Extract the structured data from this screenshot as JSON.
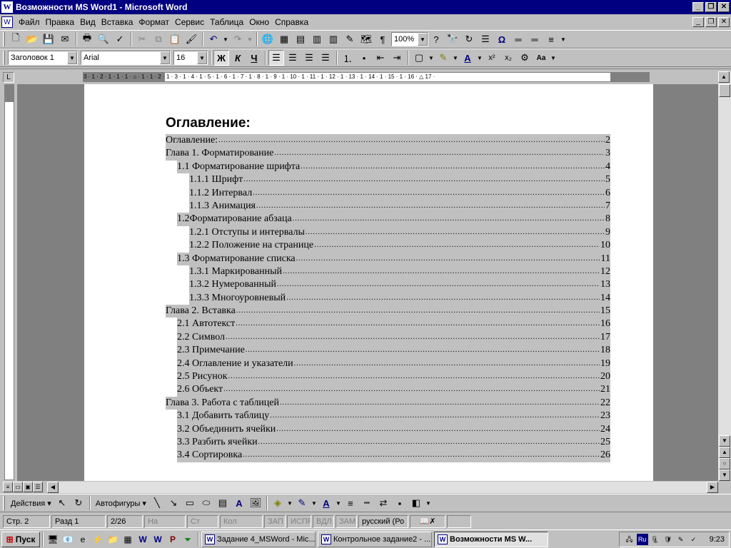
{
  "window": {
    "title": "Возможности MS Word1 - Microsoft Word"
  },
  "menu": [
    "Файл",
    "Правка",
    "Вид",
    "Вставка",
    "Формат",
    "Сервис",
    "Таблица",
    "Окно",
    "Справка"
  ],
  "standard_toolbar": {
    "zoom": "100%"
  },
  "format_toolbar": {
    "style": "Заголовок 1",
    "font": "Arial",
    "size": "16",
    "bold": "Ж",
    "italic": "К",
    "underline": "Ч"
  },
  "ruler": {
    "marks": "3 · 1 · 2 · 1 · 1 · 1 · ⌂ · 1 · 1 · 2 · 1 · 3 · 1 · 4 · 1 · 5 · 1 · 6 · 1 · 7 · 1 · 8 · 1 · 9 · 1 · 10 · 1 · 11 · 1 · 12 · 1 · 13 · 1 · 14 · 1 · 15 · 1 · 16 · △ 17 ·"
  },
  "document": {
    "heading": "Оглавление:",
    "toc": [
      {
        "level": 1,
        "text": "Оглавление:",
        "page": "2"
      },
      {
        "level": 1,
        "text": "Глава 1. Форматирование",
        "page": "3"
      },
      {
        "level": 2,
        "text": "1.1 Форматирование шрифта",
        "page": "4"
      },
      {
        "level": 3,
        "text": "1.1.1 Шрифт",
        "page": "5"
      },
      {
        "level": 3,
        "text": "1.1.2 Интервал",
        "page": "6"
      },
      {
        "level": 3,
        "text": "1.1.3 Анимация",
        "page": "7"
      },
      {
        "level": 2,
        "text": "1.2Форматирование абзаца",
        "page": "8"
      },
      {
        "level": 3,
        "text": "1.2.1 Отступы и интервалы",
        "page": "9"
      },
      {
        "level": 3,
        "text": "1.2.2 Положение на странице",
        "page": "10"
      },
      {
        "level": 2,
        "text": "1.3 Форматирование списка",
        "page": "11"
      },
      {
        "level": 3,
        "text": "1.3.1 Маркированный",
        "page": "12"
      },
      {
        "level": 3,
        "text": "1.3.2 Нумерованный",
        "page": "13"
      },
      {
        "level": 3,
        "text": "1.3.3 Многоуровневый",
        "page": "14"
      },
      {
        "level": 1,
        "text": "Глава 2. Вставка",
        "page": "15"
      },
      {
        "level": 2,
        "text": "2.1 Автотекст",
        "page": "16"
      },
      {
        "level": 2,
        "text": "2.2 Символ",
        "page": "17"
      },
      {
        "level": 2,
        "text": "2.3 Примечание",
        "page": "18"
      },
      {
        "level": 2,
        "text": "2.4 Оглавление и указатели",
        "page": "19"
      },
      {
        "level": 2,
        "text": "2.5 Рисунок",
        "page": "20"
      },
      {
        "level": 2,
        "text": "2.6 Объект",
        "page": "21"
      },
      {
        "level": 1,
        "text": "Глава 3. Работа с таблицей",
        "page": "22"
      },
      {
        "level": 2,
        "text": "3.1 Добавить таблицу",
        "page": "23"
      },
      {
        "level": 2,
        "text": "3.2 Объединить ячейки",
        "page": "24"
      },
      {
        "level": 2,
        "text": "3.3 Разбить ячейки",
        "page": "25"
      },
      {
        "level": 2,
        "text": "3.4 Сортировка",
        "page": "26"
      }
    ]
  },
  "drawing_toolbar": {
    "actions": "Действия",
    "autoshapes": "Автофигуры"
  },
  "status": {
    "page": "Стр.  2",
    "section": "Разд  1",
    "pages": "2/26",
    "at": "На",
    "line": "Ст",
    "col": "Кол",
    "rec": "ЗАП",
    "track": "ИСПР",
    "ext": "ВДЛ",
    "ovr": "ЗАМ",
    "lang": "русский (Ро"
  },
  "taskbar": {
    "start": "Пуск",
    "tasks": [
      "Задание 4_MSWord - Mic...",
      "Контрольное задание2 - ...",
      "Возможности MS W..."
    ],
    "tray_lang": "Ru",
    "clock": "9:23"
  }
}
